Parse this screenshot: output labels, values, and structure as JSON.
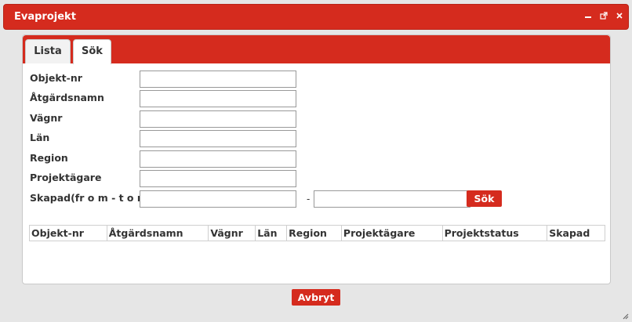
{
  "window": {
    "title": "Evaprojekt",
    "minimize_icon": "minimize-icon",
    "popout_icon": "popout-icon",
    "close_icon": "close-icon"
  },
  "tabs": [
    {
      "label": "Lista",
      "active": false
    },
    {
      "label": "Sök",
      "active": true
    }
  ],
  "form": {
    "fields": [
      {
        "label": "Objekt-nr",
        "value": ""
      },
      {
        "label": "Åtgärdsnamn",
        "value": ""
      },
      {
        "label": "Vägnr",
        "value": ""
      },
      {
        "label": "Län",
        "value": ""
      },
      {
        "label": "Region",
        "value": ""
      },
      {
        "label": "Projektägare",
        "value": ""
      }
    ],
    "date_range": {
      "label": "Skapad(fr o m - t o m)",
      "separator": "-",
      "from": "",
      "to": ""
    },
    "search_button": "Sök"
  },
  "grid": {
    "columns": [
      "Objekt-nr",
      "Åtgärdsnamn",
      "Vägnr",
      "Län",
      "Region",
      "Projektägare",
      "Projektstatus",
      "Skapad"
    ]
  },
  "footer": {
    "cancel_button": "Avbryt"
  },
  "colors": {
    "accent": "#d52b1e",
    "background": "#e6e6e6"
  }
}
